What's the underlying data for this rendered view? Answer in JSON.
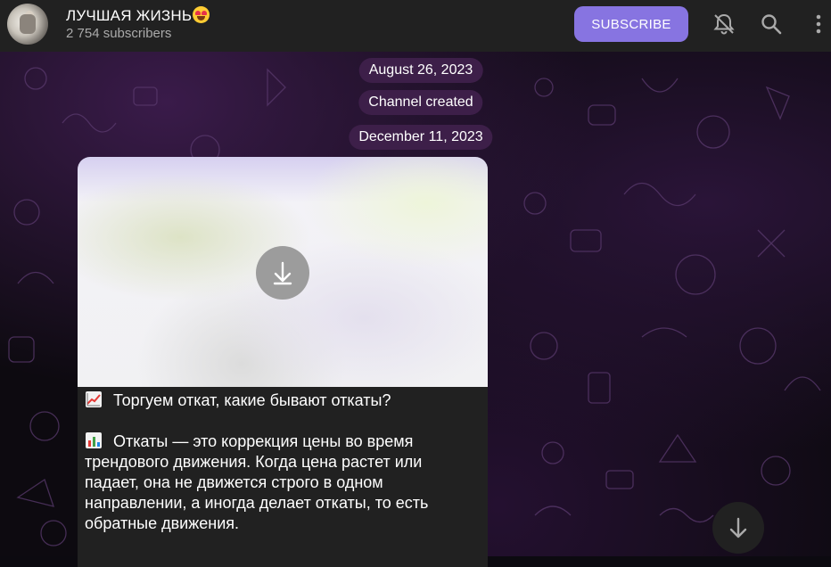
{
  "header": {
    "channel_name": "ЛУЧШАЯ ЖИЗНЬ",
    "subscribers": "2 754 subscribers",
    "subscribe_label": "SUBSCRIBE"
  },
  "dates": {
    "first": "August 26, 2023",
    "service": "Channel created",
    "second": "December 11, 2023"
  },
  "message": {
    "line1": "Торгуем откат, какие бывают откаты?",
    "para2": "Откаты — это коррекция цены во время трендового движения. Когда цена растет или падает, она не движется строго в одном направлении, а иногда делает откаты, то есть обратные движения."
  },
  "colors": {
    "accent": "#8774e1",
    "header_bg": "#212121",
    "bubble_bg": "#212121",
    "date_pill": "#3d1f49"
  },
  "icons": {
    "emoji": "heart-eyes-emoji",
    "mute": "bell-off-icon",
    "search": "search-icon",
    "menu": "more-vertical-icon",
    "download": "download-icon",
    "chart_up": "chart-increasing-emoji",
    "bar_chart": "bar-chart-emoji",
    "scroll_down": "arrow-down-icon"
  }
}
